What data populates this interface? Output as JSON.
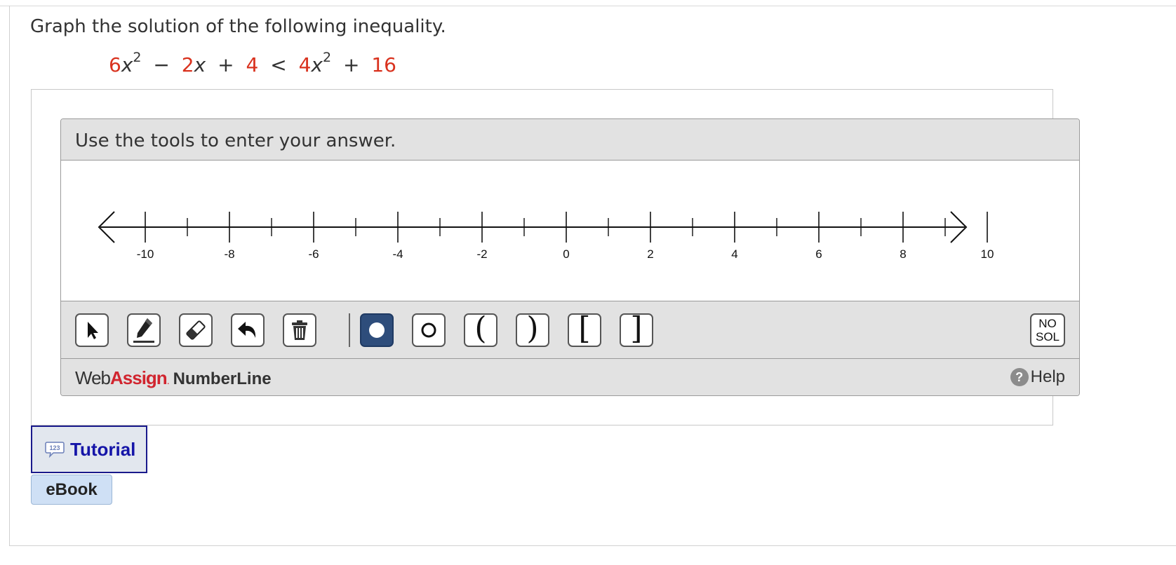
{
  "question": {
    "prompt": "Graph the solution of the following inequality.",
    "equation": {
      "lhs_a": "6",
      "lhs_a_var": "x",
      "lhs_a_exp": "2",
      "op1": "−",
      "lhs_b": "2",
      "lhs_b_var": "x",
      "op2": "+",
      "lhs_c": "4",
      "relation": "<",
      "rhs_a": "4",
      "rhs_a_var": "x",
      "rhs_a_exp": "2",
      "op3": "+",
      "rhs_c": "16"
    }
  },
  "numberline": {
    "instruction": "Use the tools to enter your answer.",
    "axis": {
      "min": -11,
      "max": 11,
      "labeled_ticks": [
        "-10",
        "-8",
        "-6",
        "-4",
        "-2",
        "0",
        "2",
        "4",
        "6",
        "8",
        "10"
      ],
      "labeled_values": [
        -10,
        -8,
        -6,
        -4,
        -2,
        0,
        2,
        4,
        6,
        8,
        10
      ],
      "minor_values": [
        -9,
        -7,
        -5,
        -3,
        -1,
        1,
        3,
        5,
        7,
        9
      ]
    },
    "toolbar": {
      "tools": [
        {
          "name": "pointer-tool",
          "icon": "arrow-cursor-icon",
          "active": false
        },
        {
          "name": "pencil-tool",
          "icon": "pencil-icon",
          "active": false
        },
        {
          "name": "eraser-tool",
          "icon": "eraser-icon",
          "active": false
        },
        {
          "name": "undo-tool",
          "icon": "undo-icon",
          "active": false
        },
        {
          "name": "delete-tool",
          "icon": "trash-icon",
          "active": false
        },
        {
          "name": "closed-point-tool",
          "icon": "filled-circle-icon",
          "active": true
        },
        {
          "name": "open-point-tool",
          "icon": "open-circle-icon",
          "active": false
        },
        {
          "name": "left-paren-tool",
          "label": "(",
          "active": false
        },
        {
          "name": "right-paren-tool",
          "label": ")",
          "active": false
        },
        {
          "name": "left-bracket-tool",
          "label": "[",
          "active": false
        },
        {
          "name": "right-bracket-tool",
          "label": "]",
          "active": false
        }
      ],
      "no_solution": {
        "line1": "NO",
        "line2": "SOL"
      }
    },
    "footer": {
      "brand_web": "Web",
      "brand_assign": "Assign",
      "brand_dot": ".",
      "brand_product": "NumberLine",
      "help_icon": "question-icon",
      "help_icon_glyph": "?",
      "help_label": "Help"
    }
  },
  "resources": {
    "tutorial_label": "Tutorial",
    "tutorial_icon_text": "123",
    "ebook_label": "eBook"
  },
  "colors": {
    "coefficient": "#d9321e",
    "brand_red": "#d1252f",
    "active_tool": "#2e4d7b",
    "tutorial_text": "#1515a8",
    "panel_gray": "#e2e2e2"
  }
}
